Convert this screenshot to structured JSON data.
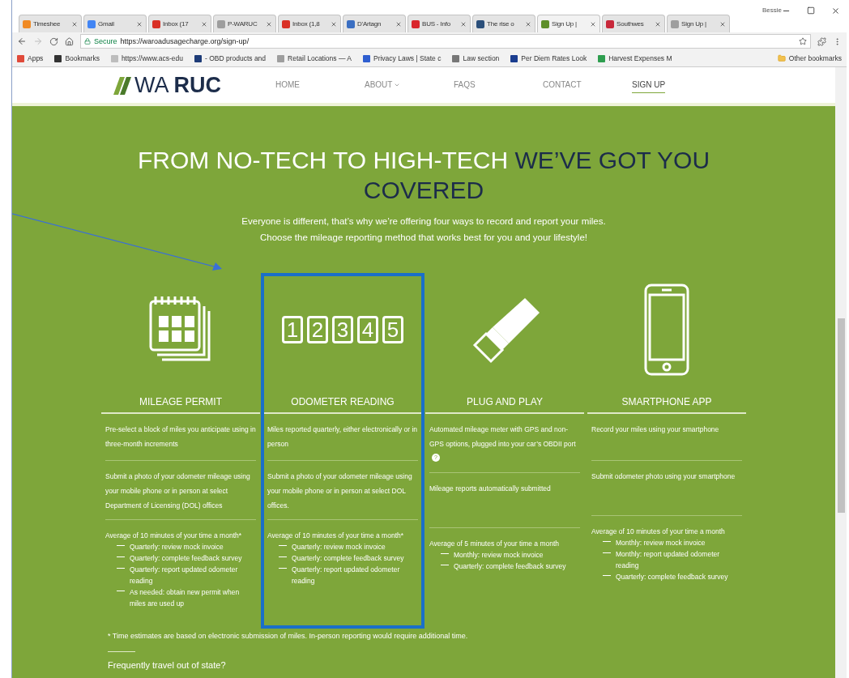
{
  "browser": {
    "profile": "Bessie",
    "tabs": [
      {
        "label": "Timeshee",
        "color": "#f08a24",
        "selected": false
      },
      {
        "label": "Gmail",
        "color": "#4285f4",
        "selected": false
      },
      {
        "label": "Inbox (17",
        "color": "#d93025",
        "selected": false
      },
      {
        "label": "P-WARUC",
        "color": "#9e9e9e",
        "selected": false
      },
      {
        "label": "Inbox (1,8",
        "color": "#d93025",
        "selected": false
      },
      {
        "label": "D'Artagn",
        "color": "#3b6fc2",
        "selected": false
      },
      {
        "label": "BUS - Info",
        "color": "#d9262c",
        "selected": false
      },
      {
        "label": "The rise o",
        "color": "#2b4f7a",
        "selected": false
      },
      {
        "label": "Sign Up |",
        "color": "#5e8f2a",
        "selected": true
      },
      {
        "label": "Southwes",
        "color": "#c8283a",
        "selected": false
      },
      {
        "label": "Sign Up |",
        "color": "#9e9e9e",
        "selected": false
      }
    ],
    "secure_label": "Secure",
    "url": "https://waroadusagecharge.org/sign-up/",
    "bookmarks": [
      {
        "label": "Apps",
        "color": "#e04a3a"
      },
      {
        "label": "Bookmarks",
        "color": "#333333"
      },
      {
        "label": "https://www.acs-edu",
        "color": "#bdbdbd"
      },
      {
        "label": "- OBD products and",
        "color": "#1e3c78"
      },
      {
        "label": "Retail Locations — A",
        "color": "#9e9e9e"
      },
      {
        "label": "Privacy Laws | State c",
        "color": "#2f5fd0"
      },
      {
        "label": "Law section",
        "color": "#777777"
      },
      {
        "label": "Per Diem Rates Look",
        "color": "#1a3d8f"
      },
      {
        "label": "Harvest Expenses M",
        "color": "#2e9e4f"
      }
    ],
    "other_bookmarks": "Other bookmarks"
  },
  "site": {
    "logo": {
      "light": "WA",
      "bold": "RUC"
    },
    "nav": [
      {
        "label": "HOME",
        "selected": false,
        "dropdown": false
      },
      {
        "label": "ABOUT",
        "selected": false,
        "dropdown": true
      },
      {
        "label": "FAQS",
        "selected": false,
        "dropdown": false
      },
      {
        "label": "CONTACT",
        "selected": false,
        "dropdown": false
      },
      {
        "label": "SIGN UP",
        "selected": true,
        "dropdown": false
      }
    ],
    "title_light": "FROM NO-TECH TO HIGH-TECH",
    "title_dark": "WE’VE GOT YOU COVERED",
    "intro": [
      "Everyone is different, that’s why we’re offering four ways to record and report your miles.",
      "Choose the mileage reporting method that works best for you and your lifestyle!"
    ],
    "options": [
      {
        "kind": "calendar",
        "title": "MILEAGE PERMIT",
        "highlighted": false,
        "rows": [
          {
            "text": "Pre-select a block of miles you anticipate using in three-month increments"
          },
          {
            "text": "Submit a photo of your odometer mileage using your mobile phone or in person at select Department of Licensing (DOL) offices"
          },
          {
            "text": "Average of 10 minutes of your time a month*",
            "bullets": [
              "Quarterly: review mock invoice",
              "Quarterly: complete feedback survey",
              "Quarterly: report updated odometer reading",
              "As needed: obtain new permit when miles are used up"
            ]
          }
        ]
      },
      {
        "kind": "digits",
        "digits": [
          "1",
          "2",
          "3",
          "4",
          "5"
        ],
        "title": "ODOMETER READING",
        "highlighted": true,
        "rows": [
          {
            "text": "Miles reported quarterly, either electronically or in person"
          },
          {
            "text": "Submit a photo of your odometer mileage using your mobile phone or in person at select DOL offices."
          },
          {
            "text": "Average of 10 minutes of your time a month*",
            "bullets": [
              "Quarterly: review mock invoice",
              "Quarterly: complete feedback survey",
              "Quarterly: report updated odometer reading"
            ]
          }
        ]
      },
      {
        "kind": "plug",
        "title": "PLUG AND PLAY",
        "highlighted": false,
        "rows": [
          {
            "text": "Automated mileage meter with GPS and non-GPS options, plugged into your car’s OBDII port",
            "info": "?"
          },
          {
            "text": "Mileage reports automatically submitted"
          },
          {
            "text": "Average of 5 minutes of your time a month",
            "bullets": [
              "Monthly: review mock invoice",
              "Quarterly: complete feedback survey"
            ]
          }
        ]
      },
      {
        "kind": "phone",
        "title": "SMARTPHONE APP",
        "highlighted": false,
        "rows": [
          {
            "text": "Record your miles using your smartphone"
          },
          {
            "text": "Submit odometer photo using your smartphone"
          },
          {
            "text": "Average of 10 minutes of your time a month",
            "bullets": [
              "Monthly: review mock invoice",
              "Monthly: report updated odometer reading",
              "Quarterly: complete feedback survey"
            ]
          }
        ]
      }
    ],
    "footnote": "* Time estimates are based on electronic submission of miles. In-person reporting would require additional time.",
    "question": "Frequently travel out of state?"
  }
}
